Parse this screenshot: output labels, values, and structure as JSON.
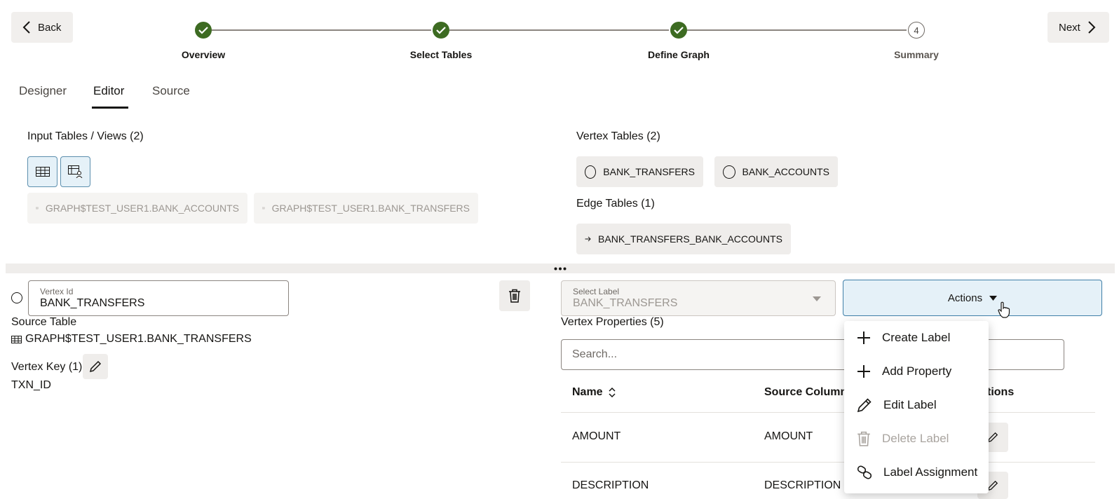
{
  "nav": {
    "back_label": "Back",
    "next_label": "Next"
  },
  "steps": [
    {
      "label": "Overview",
      "status": "done"
    },
    {
      "label": "Select Tables",
      "status": "done"
    },
    {
      "label": "Define Graph",
      "status": "done"
    },
    {
      "label": "Summary",
      "status": "pending",
      "number": "4"
    }
  ],
  "tabs": [
    "Designer",
    "Editor",
    "Source"
  ],
  "active_tab": "Editor",
  "input_tables": {
    "title": "Input Tables / Views (2)",
    "items": [
      "GRAPH$TEST_USER1.BANK_ACCOUNTS",
      "GRAPH$TEST_USER1.BANK_TRANSFERS"
    ]
  },
  "vertex_tables": {
    "title": "Vertex Tables (2)",
    "items": [
      "BANK_TRANSFERS",
      "BANK_ACCOUNTS"
    ]
  },
  "edge_tables": {
    "title": "Edge Tables (1)",
    "items": [
      "BANK_TRANSFERS_BANK_ACCOUNTS"
    ]
  },
  "vertex": {
    "id_label": "Vertex Id",
    "id_value": "BANK_TRANSFERS",
    "source_table_label": "Source Table",
    "source_table_value": "GRAPH$TEST_USER1.BANK_TRANSFERS",
    "key_label": "Vertex Key (1)",
    "key_value": "TXN_ID"
  },
  "label_select": {
    "label": "Select Label",
    "value": "BANK_TRANSFERS"
  },
  "actions": {
    "label": "Actions"
  },
  "properties": {
    "title": "Vertex Properties (5)",
    "search_placeholder": "Search...",
    "columns": [
      "Name",
      "Source Column",
      "tions"
    ],
    "rows": [
      {
        "name": "AMOUNT",
        "source": "AMOUNT"
      },
      {
        "name": "DESCRIPTION",
        "source": "DESCRIPTION"
      }
    ]
  },
  "actions_menu": [
    {
      "label": "Create Label",
      "icon": "plus-icon",
      "enabled": true
    },
    {
      "label": "Add Property",
      "icon": "plus-icon",
      "enabled": true
    },
    {
      "label": "Edit Label",
      "icon": "pencil-icon",
      "enabled": true
    },
    {
      "label": "Delete Label",
      "icon": "trash-icon",
      "enabled": false
    },
    {
      "label": "Label Assignment",
      "icon": "link-icon",
      "enabled": true
    }
  ],
  "colors": {
    "step_done": "#3d6b22",
    "accent": "#3f7fa8",
    "accent_bg": "#e5f1f8"
  }
}
